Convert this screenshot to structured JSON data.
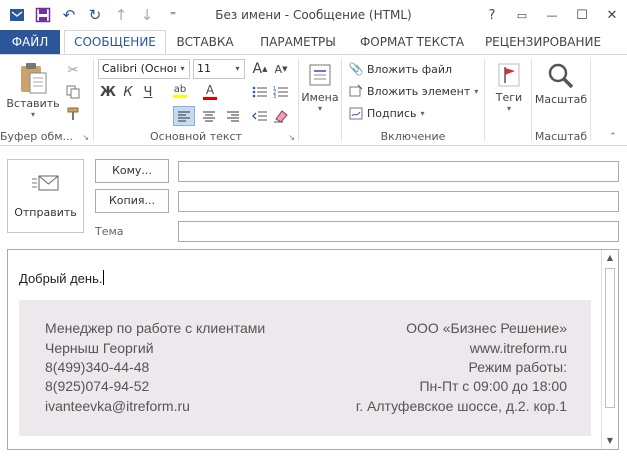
{
  "window": {
    "title": "Без имени - Сообщение (HTML)",
    "help": "?",
    "ribbon_display": "▭",
    "minimize": "—",
    "maximize": "☐",
    "close": "✕"
  },
  "qat": {
    "app_icon": "▣",
    "save": "🖫",
    "undo": "↶",
    "redo": "↻",
    "up": "↑",
    "down": "↓",
    "more": "⁼"
  },
  "tabs": {
    "file": "ФАЙЛ",
    "message": "СООБЩЕНИЕ",
    "insert": "ВСТАВКА",
    "options": "ПАРАМЕТРЫ",
    "format_text": "ФОРМАТ ТЕКСТА",
    "review": "РЕЦЕНЗИРОВАНИЕ"
  },
  "ribbon": {
    "clipboard": {
      "label": "Буфер обм...",
      "paste": "Вставить",
      "paste_arrow": "▾",
      "cut": "✂",
      "copy": "⧉",
      "format_painter": "🖌"
    },
    "basic_text": {
      "label": "Основной текст",
      "font_name": "Calibri (Основ",
      "font_size": "11",
      "grow": "A",
      "shrink": "A",
      "bullets": "☰",
      "numbering": "☷",
      "clear": "✎",
      "bold": "Ж",
      "italic": "К",
      "underline": "Ч",
      "highlight": "ab",
      "font_color": "A",
      "align_left": "≡",
      "align_center": "≡",
      "align_right": "≡",
      "outdent": "⇤",
      "indent": "⇥",
      "eraser": "⌫"
    },
    "names": {
      "label": "Имена",
      "arrow": "▾"
    },
    "include": {
      "label": "Включение",
      "attach_file": "Вложить файл",
      "attach_item": "Вложить элемент",
      "signature": "Подпись",
      "arrow": "▾"
    },
    "tags": {
      "label": "Теги",
      "arrow": "▾"
    },
    "zoom": {
      "label": "Масштаб",
      "button": "Масштаб"
    },
    "launcher": "↘"
  },
  "compose": {
    "send": "Отправить",
    "to": "Кому...",
    "cc": "Копия...",
    "subject": "Тема",
    "to_value": "",
    "cc_value": "",
    "subject_value": "",
    "greeting": "Добрый день.",
    "scroll_up": "▲",
    "scroll_down": "▼"
  },
  "signature": {
    "left": [
      "Менеджер по работе с клиентами",
      "Черныш Георгий",
      "8(499)340-44-48",
      "8(925)074-94-52",
      "ivanteevka@itreform.ru"
    ],
    "right": [
      "ООО «Бизнес Решение»",
      "www.itreform.ru",
      "Режим работы:",
      "Пн-Пт с 09:00 до 18:00",
      "г. Алтуфевское шоссе, д.2. кор.1"
    ]
  },
  "colors": {
    "accent": "#2b579a",
    "signature_bg": "#ece8ec",
    "font_color_bar": "#e00000",
    "highlight_bar": "#ffff00",
    "tags_flag": "#d13438"
  }
}
